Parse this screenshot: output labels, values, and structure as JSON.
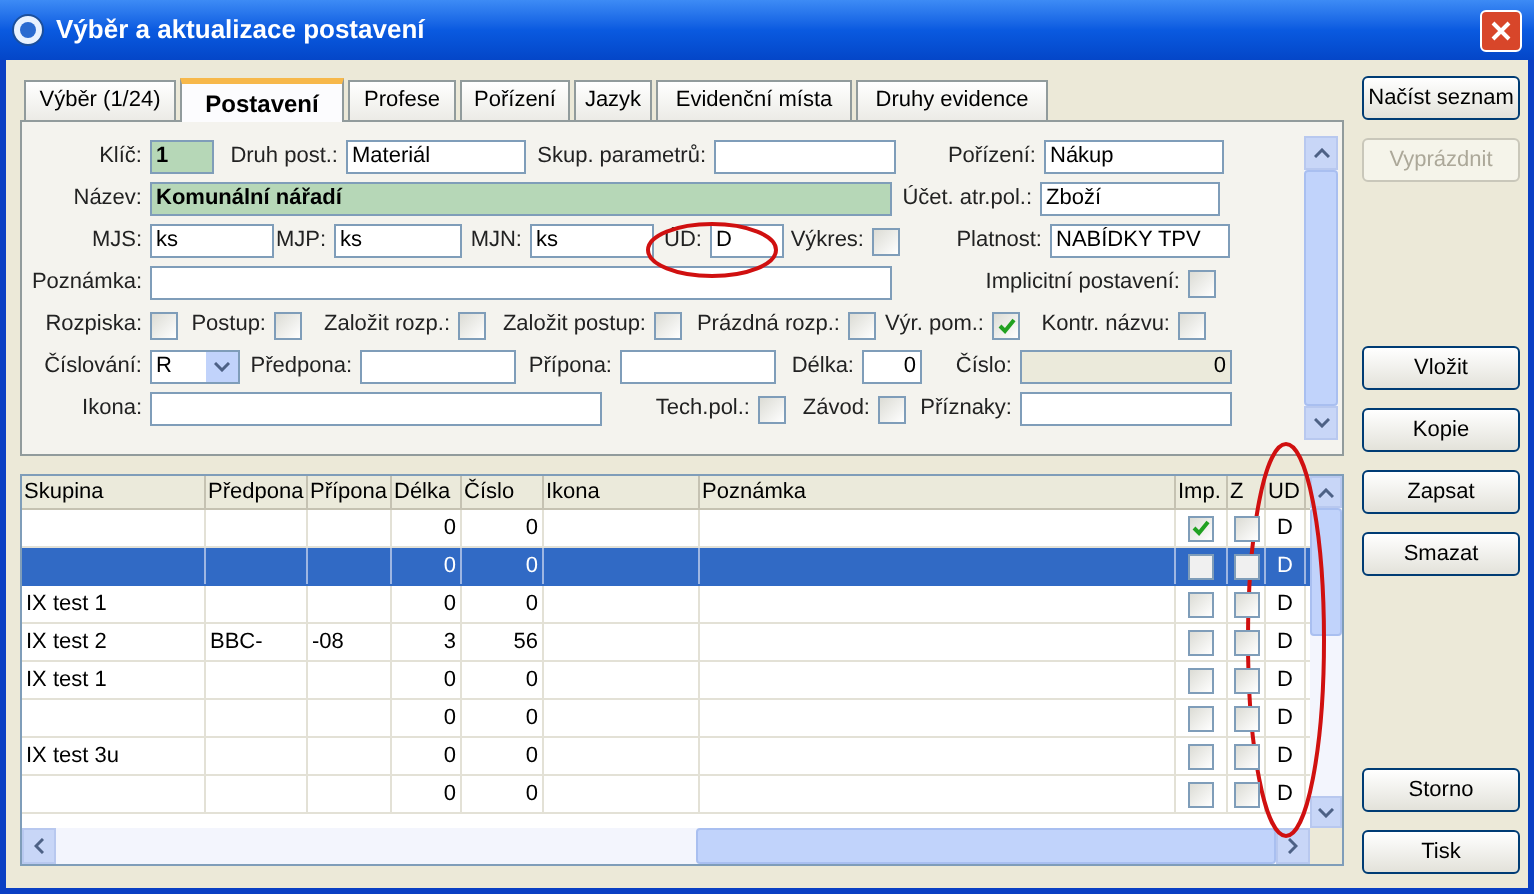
{
  "window": {
    "title": "Výběr a aktualizace postavení"
  },
  "tabs": [
    {
      "label": "Výběr (1/24)",
      "selected": false
    },
    {
      "label": "Postavení",
      "selected": true
    },
    {
      "label": "Profese",
      "selected": false
    },
    {
      "label": "Pořízení",
      "selected": false
    },
    {
      "label": "Jazyk",
      "selected": false
    },
    {
      "label": "Evidenční místa",
      "selected": false
    },
    {
      "label": "Druhy evidence",
      "selected": false
    }
  ],
  "form": {
    "rows": [
      {
        "fields": [
          {
            "label": "Klíč:",
            "kind": "field",
            "value": "1"
          },
          {
            "label": "Druh post.:",
            "kind": "field",
            "value": "Materiál"
          },
          {
            "label": "Skup. parametrů:",
            "kind": "field"
          },
          {
            "label": "Pořízení:",
            "kind": "field",
            "value": "Nákup"
          }
        ]
      },
      {
        "fields": [
          {
            "label": "Název:",
            "kind": "field",
            "value": "Komunální nářadí"
          },
          {
            "label": "Účet. atr.pol.:",
            "kind": "field",
            "value": "Zboží"
          }
        ]
      },
      {
        "fields": [
          {
            "label": "MJS:",
            "kind": "field",
            "value": "ks"
          },
          {
            "label": "MJP:",
            "kind": "field",
            "value": "ks"
          },
          {
            "label": "MJN:",
            "kind": "field",
            "value": "ks"
          },
          {
            "label": "ÚD:",
            "kind": "field",
            "value": "D"
          },
          {
            "label": "Výkres:",
            "kind": "check",
            "checked": false
          },
          {
            "label": "Platnost:",
            "kind": "field",
            "value": "NABÍDKY TPV"
          }
        ]
      },
      {
        "fields": [
          {
            "label": "Poznámka:",
            "kind": "field"
          },
          {
            "label": "Implicitní postavení:",
            "kind": "check",
            "checked": false
          }
        ]
      },
      {
        "fields": [
          {
            "label": "Rozpiska:",
            "kind": "check",
            "checked": false
          },
          {
            "label": "Postup:",
            "kind": "check",
            "checked": false
          },
          {
            "label": "Založit rozp.:",
            "kind": "check",
            "checked": false
          },
          {
            "label": "Založit postup:",
            "kind": "check",
            "checked": false
          },
          {
            "label": "Prázdná rozp.:",
            "kind": "check",
            "checked": false
          },
          {
            "label": "Výr. pom.:",
            "kind": "check",
            "checked": true
          },
          {
            "label": "Kontr. názvu:",
            "kind": "check",
            "checked": false
          }
        ]
      },
      {
        "fields": [
          {
            "label": "Číslování:",
            "kind": "select",
            "value": "R"
          },
          {
            "label": "Předpona:",
            "kind": "field"
          },
          {
            "label": "Přípona:",
            "kind": "field"
          },
          {
            "label": "Délka:",
            "kind": "field",
            "value": "0"
          },
          {
            "label": "Číslo:",
            "kind": "field",
            "value": "0",
            "disabled": true
          }
        ]
      },
      {
        "fields": [
          {
            "label": "Ikona:",
            "kind": "field"
          },
          {
            "label": "Tech.pol.:",
            "kind": "check",
            "checked": false
          },
          {
            "label": "Závod:",
            "kind": "check",
            "checked": false
          },
          {
            "label": "Příznaky:",
            "kind": "field"
          }
        ]
      }
    ]
  },
  "table": {
    "columns": [
      "Skupina",
      "Předpona",
      "Přípona",
      "Délka",
      "Číslo",
      "Ikona",
      "Poznámka",
      "Imp.",
      "Z",
      "UD"
    ],
    "rows": [
      {
        "cells": [
          "",
          "",
          "",
          "0",
          "0",
          "",
          ""
        ],
        "imp": true,
        "z": false,
        "ud": "D",
        "selected": false
      },
      {
        "cells": [
          "",
          "",
          "",
          "0",
          "0",
          "",
          ""
        ],
        "imp": false,
        "z": false,
        "ud": "D",
        "selected": true
      },
      {
        "cells": [
          "IX test 1",
          "",
          "",
          "0",
          "0",
          "",
          ""
        ],
        "imp": false,
        "z": false,
        "ud": "D",
        "selected": false
      },
      {
        "cells": [
          "IX test 2",
          "BBC-",
          "-08",
          "3",
          "56",
          "",
          ""
        ],
        "imp": false,
        "z": false,
        "ud": "D",
        "selected": false
      },
      {
        "cells": [
          "IX test 1",
          "",
          "",
          "0",
          "0",
          "",
          ""
        ],
        "imp": false,
        "z": false,
        "ud": "D",
        "selected": false
      },
      {
        "cells": [
          "",
          "",
          "",
          "0",
          "0",
          "",
          ""
        ],
        "imp": false,
        "z": false,
        "ud": "D",
        "selected": false
      },
      {
        "cells": [
          "IX test 3u",
          "",
          "",
          "0",
          "0",
          "",
          ""
        ],
        "imp": false,
        "z": false,
        "ud": "D",
        "selected": false
      },
      {
        "cells": [
          "",
          "",
          "",
          "0",
          "0",
          "",
          ""
        ],
        "imp": false,
        "z": false,
        "ud": "D",
        "selected": false
      }
    ]
  },
  "buttons": [
    {
      "label": "Načíst seznam",
      "disabled": false
    },
    {
      "label": "Vyprázdnit",
      "disabled": true
    },
    {
      "label": "Vložit",
      "disabled": false
    },
    {
      "label": "Kopie",
      "disabled": false
    },
    {
      "label": "Zapsat",
      "disabled": false
    },
    {
      "label": "Smazat",
      "disabled": false
    },
    {
      "label": "Storno",
      "disabled": false
    },
    {
      "label": "Tisk",
      "disabled": false
    }
  ]
}
